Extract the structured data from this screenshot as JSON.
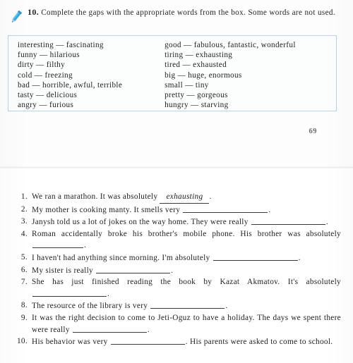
{
  "page_top": {
    "icon": "pencil-icon",
    "task_number": "10.",
    "task_instruction": "Complete the gaps with the appropriate words from the box. Some words are not used.",
    "word_box": {
      "left_column": [
        "interesting — fascinating",
        "funny — hilarious",
        "dirty — filthy",
        "cold — freezing",
        "bad — horrible, awful, terrible",
        "tasty — delicious",
        "angry — furious"
      ],
      "right_column": [
        "good — fabulous, fantastic, wonderful",
        "tiring — exhausting",
        "tired — exhausted",
        "big — huge, enormous",
        "small — tiny",
        "pretty — gorgeous",
        "hungry — starving"
      ],
      "border_color": "#b9d4e6",
      "background_color": "#fcfefe"
    },
    "page_number": "69"
  },
  "page_bottom": {
    "exercises": [
      {
        "number": "1.",
        "pre": "We ran a marathon. It was absolutely",
        "answer": "exhausting",
        "post": ".",
        "blank": null
      },
      {
        "number": "2.",
        "pre": "My mother is cooking manty. It smells very",
        "answer": null,
        "post": ".",
        "blank": "w-lg"
      },
      {
        "number": "3.",
        "pre": "Janysh told us a lot of jokes on the way home. They were really",
        "answer": null,
        "post": ".",
        "blank": "w-md"
      },
      {
        "number": "4.",
        "pre": "Roman accidentally broke his brother's mobile phone. His brother was absolutely",
        "answer": null,
        "post": ".",
        "blank": "w-sm"
      },
      {
        "number": "5.",
        "pre": "I haven't had anything since morning. I'm absolutely",
        "answer": null,
        "post": ".",
        "blank": "w-lg"
      },
      {
        "number": "6.",
        "pre": "My sister is really",
        "answer": null,
        "post": ".",
        "blank": "w-md"
      },
      {
        "number": "7.",
        "pre": "She has just finished reading the book by Kazat Akmatov. It's absolutely",
        "answer": null,
        "post": ".",
        "blank": "w-md"
      },
      {
        "number": "8.",
        "pre": "The resource of the library is very",
        "answer": null,
        "post": ".",
        "blank": "w-md"
      },
      {
        "number": "9.",
        "pre": "It was the  right decision to come to Jeti-Oguz to have a holiday. The days we spent there were really",
        "answer": null,
        "post": ".",
        "blank": "w-md"
      },
      {
        "number": "10.",
        "pre": "His behavior was very",
        "answer": null,
        "post": ". His parents were asked to come to school.",
        "blank": "w-md"
      }
    ]
  },
  "colors": {
    "pencil_body": "#35a8dd",
    "pencil_tip": "#9fd3ec",
    "box_border": "#b9d4e6",
    "text": "#1e1e1e",
    "folio": "#6b6b6b"
  }
}
